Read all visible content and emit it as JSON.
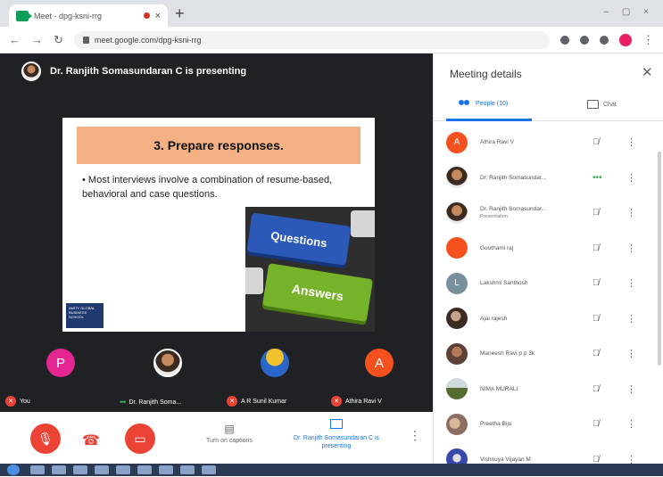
{
  "browser": {
    "tab_title": "Meet - dpg-ksni-rrg",
    "url": "meet.google.com/dpg-ksni-rrg"
  },
  "meet": {
    "presenter_banner": "Dr. Ranjith Somasundaran C is presenting",
    "slide": {
      "heading": "3. Prepare responses.",
      "bullet": "Most interviews involve a combination of resume-based, behavioral and case questions.",
      "key_questions": "Questions",
      "key_answers": "Answers",
      "logo_text": "AMITY GLOBAL BUSINESS SCHOOL"
    },
    "tiles": [
      {
        "name": "You",
        "initial": "P",
        "color": "#e52592"
      },
      {
        "name": "Dr. Ranjith Soma...",
        "initial": "",
        "color": "#9e9e9e"
      },
      {
        "name": "A R Sunil Kumar",
        "initial": "",
        "color": "#2b67c9"
      },
      {
        "name": "Athira Ravi V",
        "initial": "A",
        "color": "#f4511e"
      }
    ],
    "controls": {
      "captions_label": "Turn on captions",
      "presenting_label": "Dr. Ranjith Somasundaran C is presenting"
    }
  },
  "sidebar": {
    "title": "Meeting details",
    "close_icon": "close-icon",
    "tab_people": "People (10)",
    "tab_chat": "Chat",
    "participants": [
      {
        "name": "Athira Ravi V",
        "sub": "",
        "initial": "A",
        "color": "#f4511e"
      },
      {
        "name": "Dr. Ranjith Somasundar...",
        "sub": "",
        "initial": "",
        "color": "#8d6e63"
      },
      {
        "name": "Dr. Ranjith Somasundar...",
        "sub": "Presentation",
        "initial": "",
        "color": "#8d6e63"
      },
      {
        "name": "Gouthami raj",
        "sub": "",
        "initial": "",
        "color": "#f4511e"
      },
      {
        "name": "Lakshmi Santhosh",
        "sub": "",
        "initial": "L",
        "color": "#78909c"
      },
      {
        "name": "Ajai rajesh",
        "sub": "",
        "initial": "",
        "color": "#6d4c41"
      },
      {
        "name": "Maneesh Ravi p p 3k",
        "sub": "",
        "initial": "",
        "color": "#5d4037"
      },
      {
        "name": "NIMA MURALI",
        "sub": "",
        "initial": "",
        "color": "#556b2f"
      },
      {
        "name": "Preetha Biju",
        "sub": "",
        "initial": "",
        "color": "#a1887f"
      },
      {
        "name": "Vishnuya Vijayan M",
        "sub": "",
        "initial": "",
        "color": "#3949ab"
      }
    ]
  }
}
